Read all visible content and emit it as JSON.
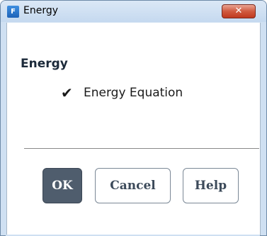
{
  "window": {
    "title": "Energy",
    "app_icon_letter": "F",
    "close_label": "✕"
  },
  "panel": {
    "group_label": "Energy",
    "checkbox": {
      "label": "Energy Equation",
      "checked": true,
      "mark": "✔"
    }
  },
  "buttons": {
    "ok_label": "OK",
    "cancel_label": "Cancel",
    "help_label": "Help"
  },
  "colors": {
    "titlebar": "#c5d9ef",
    "close_button": "#c0391f",
    "ok_button": "#4f5d6d",
    "secondary_button_text": "#3c4a5a"
  }
}
